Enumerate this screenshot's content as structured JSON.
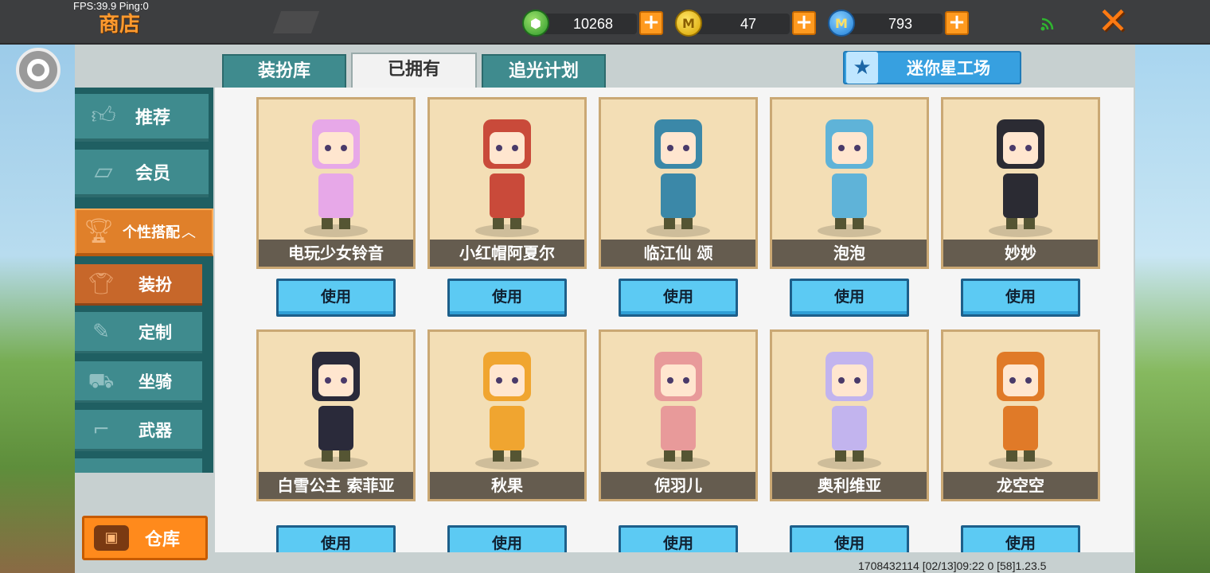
{
  "status": {
    "fps": "FPS:39.9  Ping:0"
  },
  "header": {
    "title": "商店",
    "currencies": [
      {
        "icon": "green-gem-icon",
        "value": "10268"
      },
      {
        "icon": "gold-coin-icon",
        "value": "47"
      },
      {
        "icon": "mini-coin-icon",
        "value": "793"
      }
    ]
  },
  "sidebar": {
    "items": [
      {
        "label": "推荐",
        "icon": "thumbs-up-icon"
      },
      {
        "label": "会员",
        "icon": "member-icon"
      },
      {
        "label": "个性搭配",
        "icon": "trophy-icon",
        "expanded": true
      }
    ],
    "sub_items": [
      {
        "label": "装扮",
        "icon": "shirt-icon"
      },
      {
        "label": "定制",
        "icon": "pencil-icon"
      },
      {
        "label": "坐骑",
        "icon": "mount-icon"
      },
      {
        "label": "武器",
        "icon": "gun-icon"
      }
    ],
    "warehouse_label": "仓库"
  },
  "tabs": [
    {
      "label": "装扮库"
    },
    {
      "label": "已拥有"
    },
    {
      "label": "追光计划"
    }
  ],
  "star_workshop_label": "迷你星工场",
  "use_label": "使用",
  "skins": [
    {
      "name": "电玩少女铃音",
      "color": "#e7a8e8"
    },
    {
      "name": "小红帽阿夏尔",
      "color": "#c94a3a"
    },
    {
      "name": "临江仙 颂",
      "color": "#3b88a8"
    },
    {
      "name": "泡泡",
      "color": "#5fb3d8"
    },
    {
      "name": "妙妙",
      "color": "#2b2b33"
    },
    {
      "name": "白雪公主 索菲亚",
      "color": "#2a2a3a"
    },
    {
      "name": "秋果",
      "color": "#f0a530"
    },
    {
      "name": "倪羽儿",
      "color": "#e89a9a"
    },
    {
      "name": "奥利维亚",
      "color": "#c2b4ee"
    },
    {
      "name": "龙空空",
      "color": "#e07a28"
    }
  ],
  "footer": {
    "info": "1708432114     [02/13]09:22 0   [58]1.23.5"
  }
}
